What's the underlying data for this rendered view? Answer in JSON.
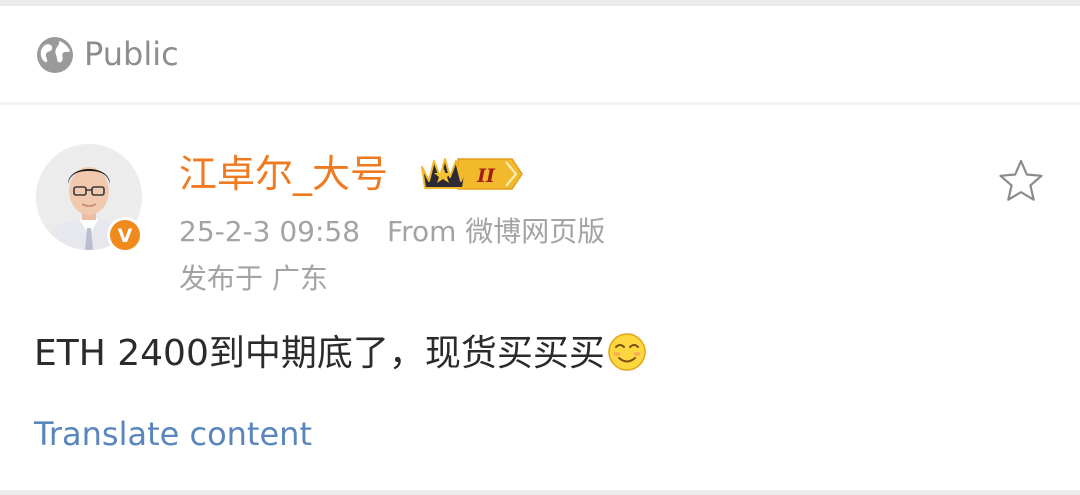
{
  "visibility": {
    "label": "Public",
    "icon": "globe-icon"
  },
  "post": {
    "author": {
      "name": "江卓尔_大号",
      "verified_badge_letter": "V",
      "member_level": "II",
      "avatar_icon": "person-portrait"
    },
    "time": "25-2-3 09:58",
    "source": "From 微博网页版",
    "location": "发布于 广东",
    "text": "ETH 2400到中期底了，现货买买买",
    "emoji": "smirk-face-emoji",
    "translate_label": "Translate content",
    "favorite_icon": "star-outline-icon"
  },
  "colors": {
    "author": "#f07a1f",
    "meta": "#a3a3a3",
    "body_text": "#2b2b2b",
    "link": "#5a85bd",
    "badge": "#f08a1c",
    "crown_gold": "#f3b92c"
  }
}
